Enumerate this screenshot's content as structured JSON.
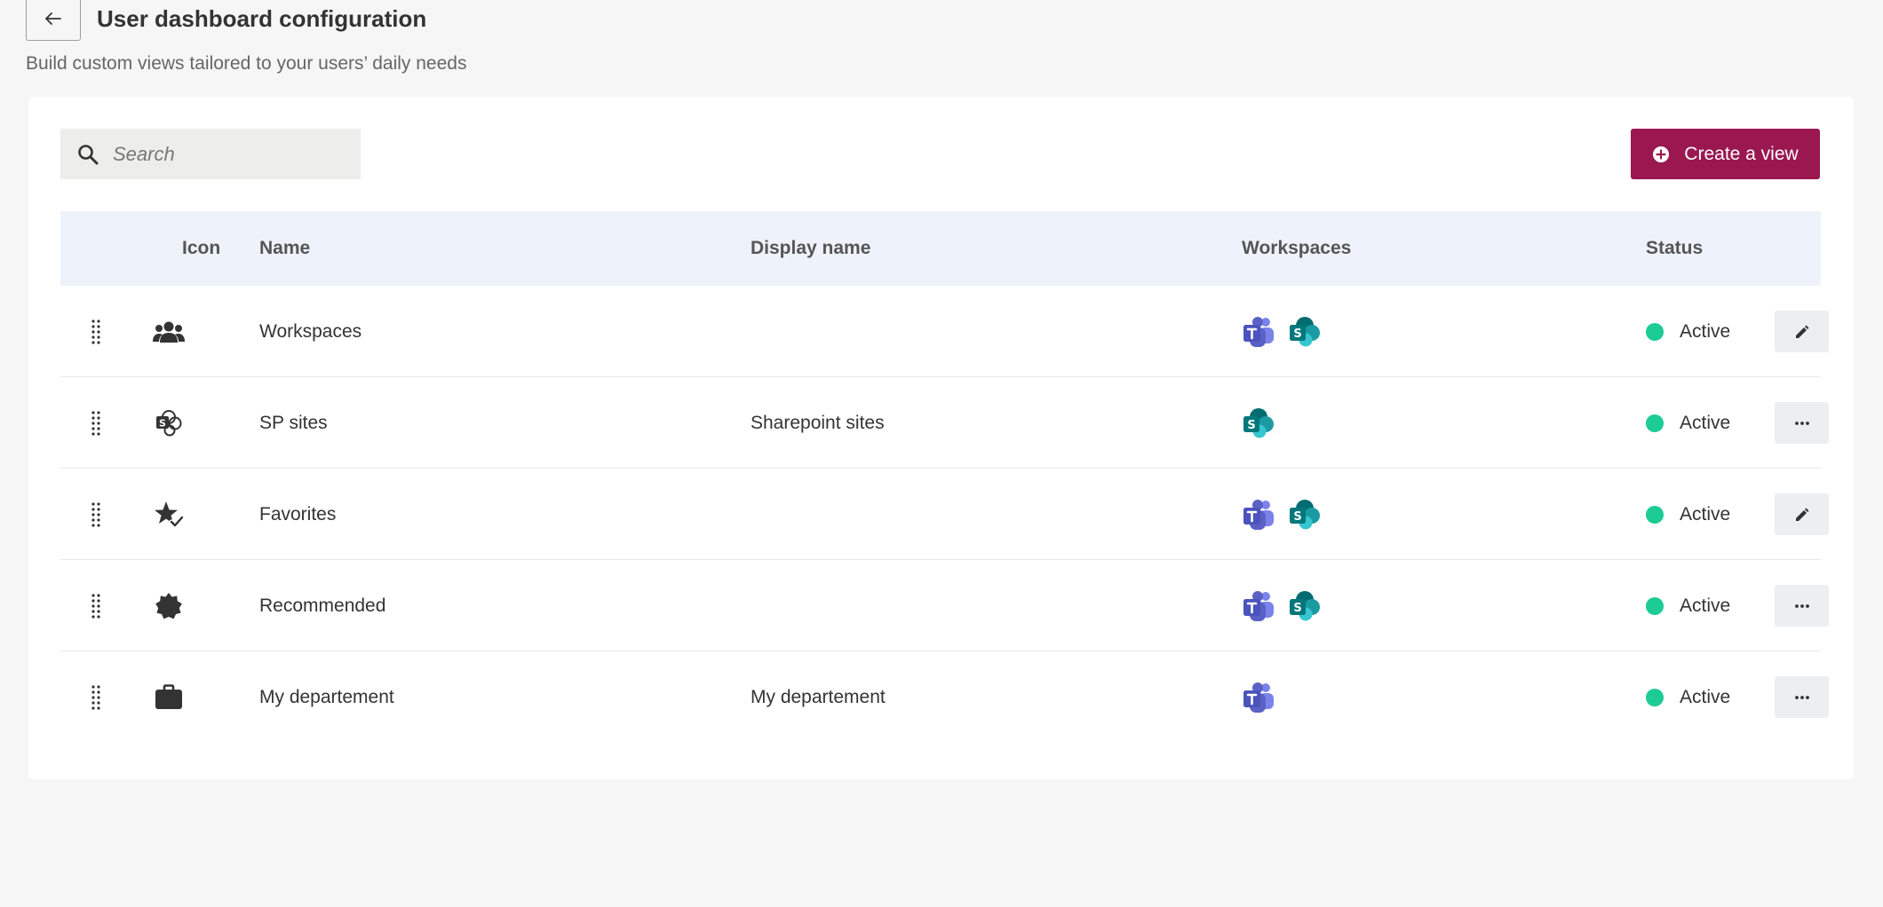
{
  "header": {
    "title": "User dashboard configuration",
    "subtitle": "Build custom views tailored to your users’ daily needs"
  },
  "toolbar": {
    "search_placeholder": "Search",
    "create_label": "Create a view"
  },
  "table": {
    "columns": {
      "icon": "Icon",
      "name": "Name",
      "display_name": "Display name",
      "workspaces": "Workspaces",
      "status": "Status"
    },
    "rows": [
      {
        "icon": "people-group-icon",
        "name": "Workspaces",
        "display_name": "",
        "workspaces": [
          "teams",
          "sharepoint"
        ],
        "status": "Active",
        "action": "edit"
      },
      {
        "icon": "sharepoint-sites-icon",
        "name": "SP sites",
        "display_name": "Sharepoint sites",
        "workspaces": [
          "sharepoint"
        ],
        "status": "Active",
        "action": "more"
      },
      {
        "icon": "star-check-icon",
        "name": "Favorites",
        "display_name": "",
        "workspaces": [
          "teams",
          "sharepoint"
        ],
        "status": "Active",
        "action": "edit"
      },
      {
        "icon": "badge-seal-icon",
        "name": "Recommended",
        "display_name": "",
        "workspaces": [
          "teams",
          "sharepoint"
        ],
        "status": "Active",
        "action": "more"
      },
      {
        "icon": "briefcase-icon",
        "name": "My departement",
        "display_name": "My departement",
        "workspaces": [
          "teams"
        ],
        "status": "Active",
        "action": "more"
      }
    ]
  },
  "colors": {
    "accent": "#9a1750",
    "status_active": "#1ccc92",
    "header_bg": "#eef2fa"
  }
}
